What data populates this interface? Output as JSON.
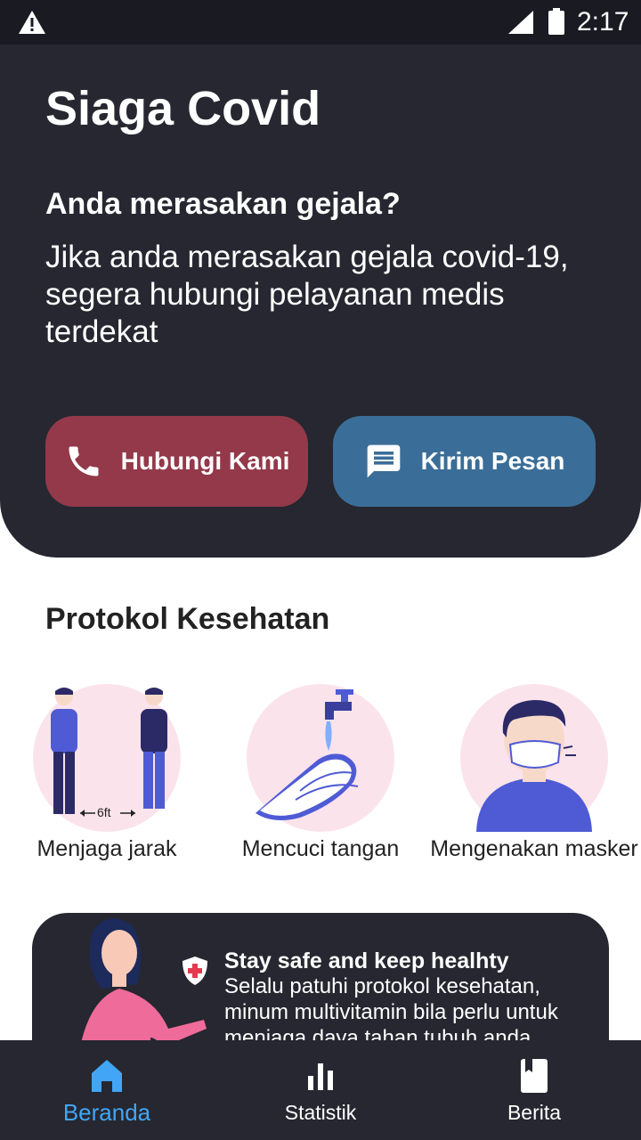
{
  "status_bar": {
    "time": "2:17",
    "icons": [
      "warning-icon",
      "signal-icon",
      "battery-icon"
    ]
  },
  "header": {
    "title": "Siaga Covid",
    "question": "Anda merasakan gejala?",
    "description": "Jika anda merasakan gejala covid-19, segera hubungi pelayanan medis terdekat",
    "call_button": {
      "label": "Hubungi Kami",
      "icon": "phone-icon",
      "color": "#93394a"
    },
    "message_button": {
      "label": "Kirim Pesan",
      "icon": "message-icon",
      "color": "#3a6e98"
    }
  },
  "protocol": {
    "title": "Protokol Kesehatan",
    "items": [
      {
        "label": "Menjaga jarak",
        "distance_text": "6ft"
      },
      {
        "label": "Mencuci tangan"
      },
      {
        "label": "Mengenakan masker"
      }
    ]
  },
  "tip": {
    "title": "Stay safe and keep healhty",
    "body": "Selalu patuhi protokol kesehatan, minum multivitamin bila perlu untuk menjaga daya tahan tubuh anda"
  },
  "nav": {
    "items": [
      {
        "label": "Beranda",
        "icon": "home-icon",
        "active": true
      },
      {
        "label": "Statistik",
        "icon": "bar-chart-icon",
        "active": false
      },
      {
        "label": "Berita",
        "icon": "book-icon",
        "active": false
      }
    ],
    "active_color": "#42a5f5"
  }
}
